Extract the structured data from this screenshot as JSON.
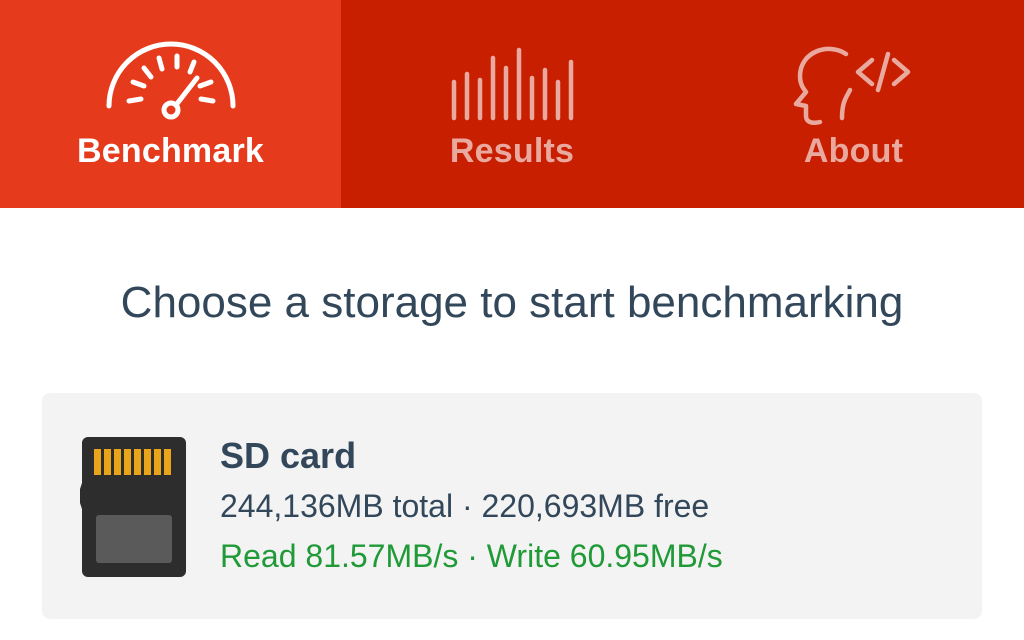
{
  "tabs": [
    {
      "label": "Benchmark",
      "icon": "speedometer-icon",
      "active": true
    },
    {
      "label": "Results",
      "icon": "bars-icon",
      "active": false
    },
    {
      "label": "About",
      "icon": "head-code-icon",
      "active": false
    }
  ],
  "main": {
    "heading": "Choose a storage to start benchmarking"
  },
  "storage": {
    "name": "SD card",
    "icon": "sd-card-icon",
    "capacity": "244,136MB total · 220,693MB free",
    "speed": "Read 81.57MB/s · Write 60.95MB/s"
  },
  "colors": {
    "tab_bar": "#c81f00",
    "tab_active": "#e53b1c",
    "heading_text": "#33475b",
    "speed_text": "#1f9a37",
    "card_background": "#f3f3f3",
    "sd_contacts": "#e8a51c"
  }
}
